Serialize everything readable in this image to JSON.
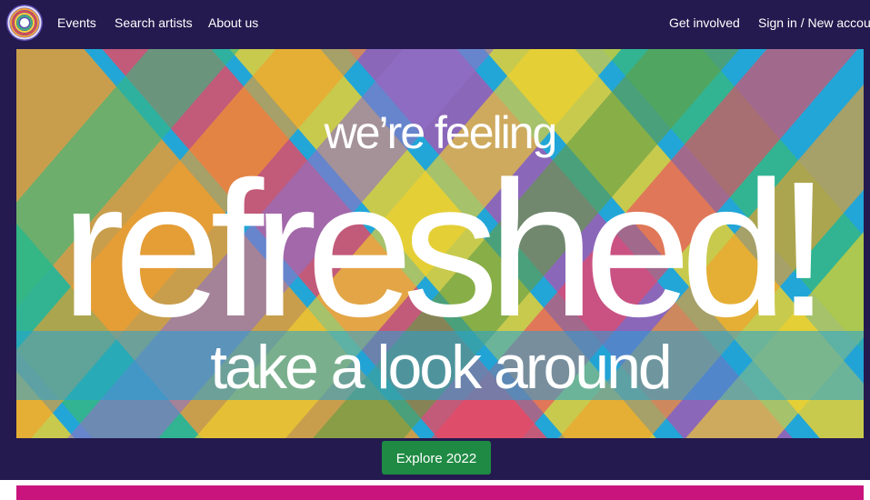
{
  "nav": {
    "logo_icon": "concentric-rings-logo",
    "links": [
      {
        "label": "Events"
      },
      {
        "label": "Search artists"
      },
      {
        "label": "About us"
      }
    ],
    "right_links": [
      {
        "label": "Get involved"
      },
      {
        "label": "Sign in / New account"
      }
    ]
  },
  "hero": {
    "line1": "we’re feeling",
    "line2": "refreshed!",
    "line3": "take a look around"
  },
  "cta": {
    "label": "Explore 2022",
    "color": "#1f8a44"
  },
  "colors": {
    "background": "#241a4f",
    "accent_band": "#c8147c"
  }
}
